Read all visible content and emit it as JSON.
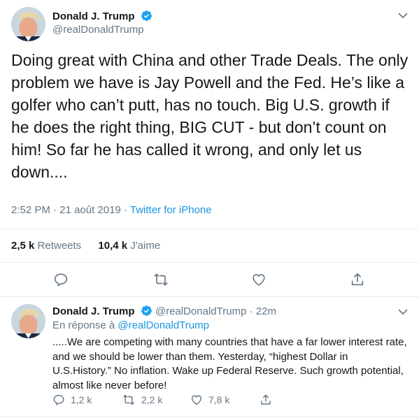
{
  "main_tweet": {
    "author_name": "Donald J. Trump",
    "author_handle": "@realDonaldTrump",
    "text": "Doing great with China and other Trade Deals. The only problem we have is Jay Powell and the Fed. He’s like a golfer who can’t putt, has no touch. Big U.S. growth if he does the right thing, BIG CUT - but don’t count on him! So far he has called it wrong, and only let us down....",
    "time": "2:52 PM",
    "date": "21 août 2019",
    "separator": "·",
    "source": "Twitter for iPhone",
    "retweets_count": "2,5 k",
    "retweets_label": "Retweets",
    "likes_count": "10,4 k",
    "likes_label": "J'aime"
  },
  "reply_tweet": {
    "author_name": "Donald J. Trump",
    "author_handle": "@realDonaldTrump",
    "separator": "·",
    "time_ago": "22m",
    "reply_to_prefix": "En réponse à",
    "reply_to_handle": "@realDonaldTrump",
    "text": ".....We are competing with many countries that have a far lower interest rate, and we should be lower than them. Yesterday, “highest Dollar in U.S.History.” No inflation. Wake up Federal Reserve. Such growth potential, almost like never before!",
    "reply_count": "1,2 k",
    "retweet_count": "2,2 k",
    "like_count": "7,8 k"
  },
  "colors": {
    "accent": "#1b95e0",
    "text": "#14171a",
    "muted": "#657786",
    "divider": "#e6ecf0",
    "verified": "#1da1f2"
  }
}
